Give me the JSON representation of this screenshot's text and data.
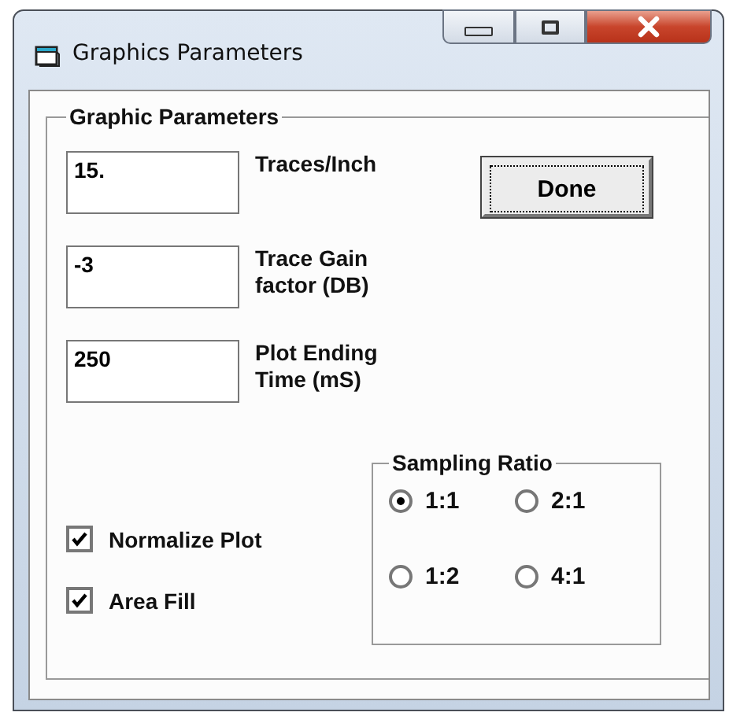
{
  "window": {
    "title": "Graphics Parameters"
  },
  "group": {
    "title": "Graphic Parameters"
  },
  "fields": [
    {
      "value": "15.",
      "label": "Traces/Inch"
    },
    {
      "value": "-3",
      "label": "Trace Gain\nfactor (DB)"
    },
    {
      "value": "250",
      "label": "Plot Ending\nTime (mS)"
    }
  ],
  "done_button": "Done",
  "checkboxes": [
    {
      "label": "Normalize Plot",
      "checked": true
    },
    {
      "label": "Area Fill",
      "checked": true
    }
  ],
  "sampling": {
    "title": "Sampling Ratio",
    "options": [
      {
        "label": "1:1",
        "selected": true
      },
      {
        "label": "2:1",
        "selected": false
      },
      {
        "label": "1:2",
        "selected": false
      },
      {
        "label": "4:1",
        "selected": false
      }
    ]
  }
}
